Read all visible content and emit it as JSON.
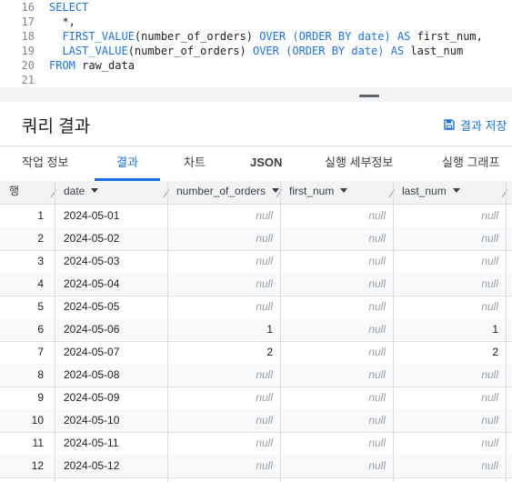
{
  "editor": {
    "lines": [
      {
        "num": "16",
        "tokens": [
          {
            "t": "SELECT",
            "c": "kw"
          }
        ]
      },
      {
        "num": "17",
        "tokens": [
          {
            "t": "  *,",
            "c": "tx"
          }
        ]
      },
      {
        "num": "18",
        "tokens": [
          {
            "t": "  FIRST_VALUE",
            "c": "kw"
          },
          {
            "t": "(number_of_orders) ",
            "c": "tx"
          },
          {
            "t": "OVER",
            "c": "kw"
          },
          {
            "t": " ",
            "c": "tx"
          },
          {
            "t": "(ORDER BY ",
            "c": "kw"
          },
          {
            "t": "date",
            "c": "kw"
          },
          {
            "t": ") ",
            "c": "kw"
          },
          {
            "t": "AS",
            "c": "kw"
          },
          {
            "t": " first_num,",
            "c": "tx"
          }
        ]
      },
      {
        "num": "19",
        "tokens": [
          {
            "t": "  LAST_VALUE",
            "c": "kw"
          },
          {
            "t": "(number_of_orders) ",
            "c": "tx"
          },
          {
            "t": "OVER",
            "c": "kw"
          },
          {
            "t": " ",
            "c": "tx"
          },
          {
            "t": "(ORDER BY ",
            "c": "kw"
          },
          {
            "t": "date",
            "c": "kw"
          },
          {
            "t": ") ",
            "c": "kw"
          },
          {
            "t": "AS",
            "c": "kw"
          },
          {
            "t": " last_num",
            "c": "tx"
          }
        ]
      },
      {
        "num": "20",
        "tokens": [
          {
            "t": "FROM",
            "c": "kw"
          },
          {
            "t": " raw_data",
            "c": "tx"
          }
        ]
      },
      {
        "num": "21",
        "tokens": []
      }
    ]
  },
  "results": {
    "title": "쿼리 결과",
    "save_label": "결과 저장"
  },
  "tabs": [
    {
      "label": "작업 정보",
      "active": false
    },
    {
      "label": "결과",
      "active": true
    },
    {
      "label": "차트",
      "active": false
    },
    {
      "label": "JSON",
      "active": false,
      "bold": true
    },
    {
      "label": "실행 세부정보",
      "active": false
    },
    {
      "label": "실행 그래프",
      "active": false
    }
  ],
  "table": {
    "row_header": "행",
    "columns": [
      "date",
      "number_of_orders",
      "first_num",
      "last_num"
    ],
    "null_text": "null",
    "rows": [
      {
        "idx": "1",
        "date": "2024-05-01",
        "number_of_orders": null,
        "first_num": null,
        "last_num": null
      },
      {
        "idx": "2",
        "date": "2024-05-02",
        "number_of_orders": null,
        "first_num": null,
        "last_num": null
      },
      {
        "idx": "3",
        "date": "2024-05-03",
        "number_of_orders": null,
        "first_num": null,
        "last_num": null
      },
      {
        "idx": "4",
        "date": "2024-05-04",
        "number_of_orders": null,
        "first_num": null,
        "last_num": null
      },
      {
        "idx": "5",
        "date": "2024-05-05",
        "number_of_orders": null,
        "first_num": null,
        "last_num": null
      },
      {
        "idx": "6",
        "date": "2024-05-06",
        "number_of_orders": "1",
        "first_num": null,
        "last_num": "1"
      },
      {
        "idx": "7",
        "date": "2024-05-07",
        "number_of_orders": "2",
        "first_num": null,
        "last_num": "2"
      },
      {
        "idx": "8",
        "date": "2024-05-08",
        "number_of_orders": null,
        "first_num": null,
        "last_num": null
      },
      {
        "idx": "9",
        "date": "2024-05-09",
        "number_of_orders": null,
        "first_num": null,
        "last_num": null
      },
      {
        "idx": "10",
        "date": "2024-05-10",
        "number_of_orders": null,
        "first_num": null,
        "last_num": null
      },
      {
        "idx": "11",
        "date": "2024-05-11",
        "number_of_orders": null,
        "first_num": null,
        "last_num": null
      },
      {
        "idx": "12",
        "date": "2024-05-12",
        "number_of_orders": null,
        "first_num": null,
        "last_num": null
      }
    ]
  },
  "colors": {
    "accent": "#1a73e8",
    "null": "#9aa0a6",
    "stripe": "#f8f9fa"
  }
}
